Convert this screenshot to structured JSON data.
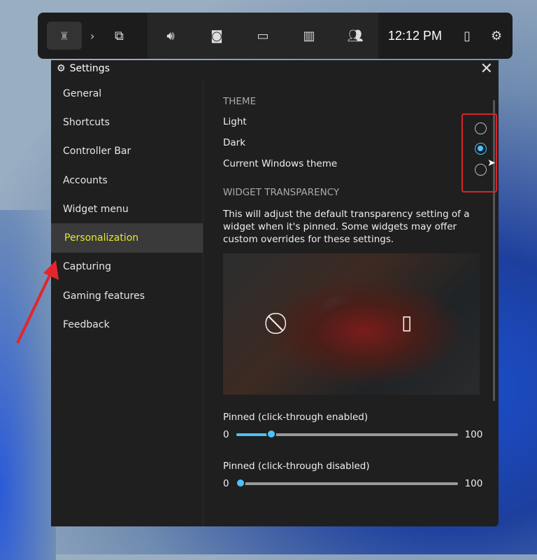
{
  "taskbar": {
    "time": "12:12 PM",
    "icons": [
      "xbox-home-icon",
      "chevron-right-icon",
      "widget-gallery-icon",
      "audio-icon",
      "capture-icon",
      "performance-icon",
      "resources-icon",
      "xbox-social-icon",
      "mouse-icon",
      "settings-icon"
    ]
  },
  "window": {
    "title": "Settings"
  },
  "sidebar": {
    "items": [
      {
        "label": "General"
      },
      {
        "label": "Shortcuts"
      },
      {
        "label": "Controller Bar"
      },
      {
        "label": "Accounts"
      },
      {
        "label": "Widget menu"
      },
      {
        "label": "Personalization"
      },
      {
        "label": "Capturing"
      },
      {
        "label": "Gaming features"
      },
      {
        "label": "Feedback"
      }
    ],
    "selected": "Personalization"
  },
  "theme": {
    "heading": "THEME",
    "options": [
      {
        "label": "Light",
        "checked": false
      },
      {
        "label": "Dark",
        "checked": true
      },
      {
        "label": "Current Windows theme",
        "checked": false
      }
    ]
  },
  "transparency": {
    "heading": "WIDGET TRANSPARENCY",
    "description": "This will adjust the default transparency setting of a widget when it's pinned. Some widgets may offer custom overrides for these settings.",
    "sliders": [
      {
        "label": "Pinned (click-through enabled)",
        "min": "0",
        "max": "100",
        "value": 16
      },
      {
        "label": "Pinned (click-through disabled)",
        "min": "0",
        "max": "100",
        "value": 2
      }
    ]
  },
  "colors": {
    "accent": "#4cc2ff",
    "highlight": "#e3e832",
    "annotation": "#d9242a"
  }
}
